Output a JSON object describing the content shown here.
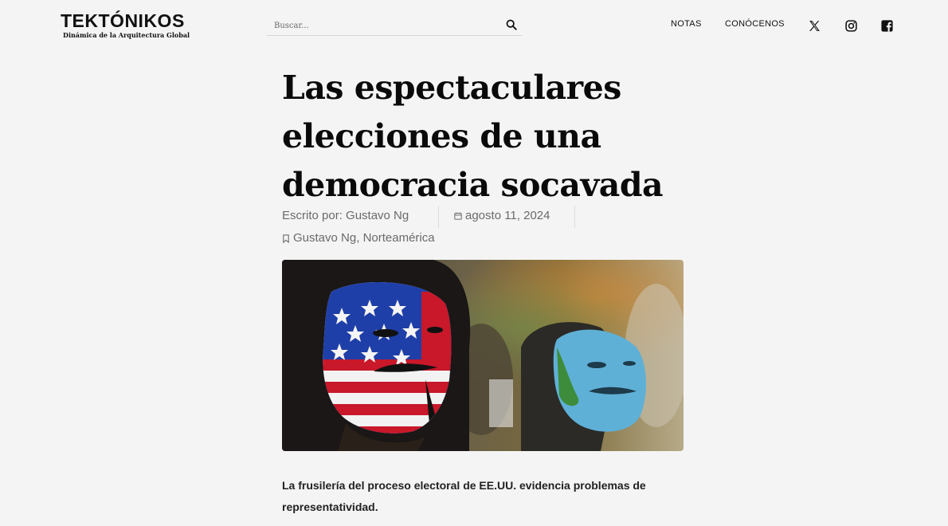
{
  "header": {
    "logo_main": "TEKTÓNIKOS",
    "logo_sub": "Dinámica de la Arquitectura Global",
    "search_placeholder": "Buscar...",
    "nav": [
      "NOTAS",
      "CONÓCENOS"
    ],
    "social_icons": [
      "x-icon",
      "instagram-icon",
      "facebook-icon"
    ]
  },
  "article": {
    "title": "Las espectaculares elecciones de una democracia socavada",
    "author_label": "Escrito por: Gustavo Ng",
    "date": "agosto 11, 2024",
    "categories": [
      "Gustavo Ng",
      "Norteamérica"
    ],
    "category_sep": ", ",
    "lede": "La frusilería del proceso electoral de EE.UU. evidencia problemas de representatividad."
  },
  "colors": {
    "background": "#f4f4f4",
    "logo_accent": "#1b3fbf",
    "meta_text": "#6a6a6a"
  }
}
